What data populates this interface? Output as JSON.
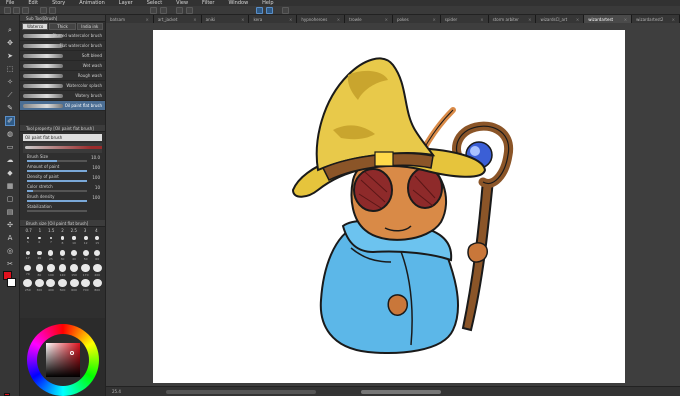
{
  "menu": [
    "File",
    "Edit",
    "Story",
    "Animation",
    "Layer",
    "Select",
    "View",
    "Filter",
    "Window",
    "Help"
  ],
  "doc_tabs": [
    {
      "label": "batsam",
      "active": false
    },
    {
      "label": "art_jacket",
      "active": false
    },
    {
      "label": "aniki",
      "active": false
    },
    {
      "label": "kera",
      "active": false
    },
    {
      "label": "hypnoheroes",
      "active": false
    },
    {
      "label": "trowle",
      "active": false
    },
    {
      "label": "pokes",
      "active": false
    },
    {
      "label": "spider",
      "active": false
    },
    {
      "label": "storm arbiter",
      "active": false
    },
    {
      "label": "wizardsCI_art",
      "active": false
    },
    {
      "label": "wizardartest",
      "active": true
    },
    {
      "label": "wizardartest2",
      "active": false
    }
  ],
  "subtool": {
    "header": "Sub Tool[Brush]",
    "tabs": [
      "Waterco",
      "Thick",
      "India ink"
    ],
    "brushes": [
      {
        "name": "Blurred watercolor brush",
        "active": false
      },
      {
        "name": "Flat watercolor brush",
        "active": false
      },
      {
        "name": "Soft bleed",
        "active": false
      },
      {
        "name": "Wet wash",
        "active": false
      },
      {
        "name": "Rough wash",
        "active": false
      },
      {
        "name": "Watercolor splash",
        "active": false
      },
      {
        "name": "Watery brush",
        "active": false
      },
      {
        "name": "Oil paint flat brush",
        "active": true
      }
    ]
  },
  "toolprop": {
    "header": "Tool property [Oil paint flat brush]",
    "brush_name": "Oil paint flat brush",
    "properties": [
      {
        "label": "Brush Size",
        "value": "10.0",
        "level": 0.5
      },
      {
        "label": "Amount of paint",
        "value": "100",
        "level": 1.0
      },
      {
        "label": "Density of paint",
        "value": "100",
        "level": 1.0
      },
      {
        "label": "Color stretch",
        "value": "10",
        "level": 0.1
      },
      {
        "label": "Brush density",
        "value": "100",
        "level": 1.0
      },
      {
        "label": "Stabilization",
        "value": "",
        "level": 0.0
      }
    ]
  },
  "brushsize": {
    "header": "Brush size [Oil paint flat brush]",
    "top_values": [
      "0.7",
      "1",
      "1.5",
      "2",
      "2.5",
      "3",
      "4"
    ],
    "sizes": [
      "5",
      "6",
      "7",
      "8",
      "10",
      "12",
      "15",
      "17",
      "20",
      "25",
      "30",
      "40",
      "50",
      "60",
      "70",
      "80",
      "100",
      "120",
      "150",
      "170",
      "200",
      "250",
      "300",
      "400",
      "500",
      "600",
      "700",
      "800"
    ]
  },
  "colors": {
    "main": "#e0121e",
    "sub": "#ffffff",
    "accent": "#2f5a86"
  },
  "status": {
    "zoom": "25.4"
  }
}
